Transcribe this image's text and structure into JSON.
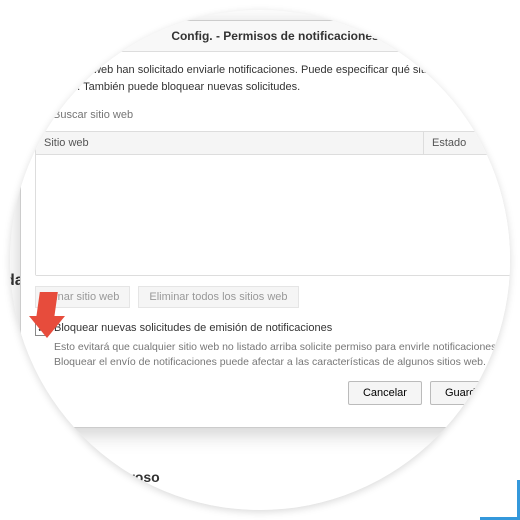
{
  "dialog": {
    "title": "Config. - Permisos de notificaciones",
    "intro": "entes sitios web han solicitado enviarle notificaciones. Puede especificar qué sitios web tienen permis o. También puede bloquear nuevas solicitudes.",
    "search_placeholder": "Buscar sitio web",
    "columns": {
      "site": "Sitio web",
      "status": "Estado"
    },
    "remove_site": "minar sitio web",
    "remove_all": "Eliminar todos los sitios web",
    "block_checkbox": {
      "checked": true,
      "label": "Bloquear nuevas solicitudes de emisión de notificaciones",
      "description": "Esto evitará que cualquier sitio web no listado arriba solicite permiso para envirle notificaciones. Bloquear el envío de notificaciones puede afectar a las características de algunos sitios web."
    },
    "cancel": "Cancelar",
    "save": "Guardar ca"
  },
  "background": {
    "dat": "dat",
    "peligroso": "e peligroso"
  }
}
